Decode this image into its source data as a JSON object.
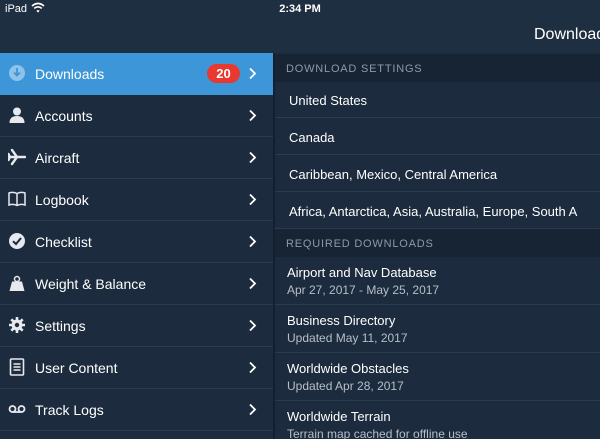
{
  "status": {
    "carrier": "iPad",
    "time": "2:34 PM"
  },
  "nav": {
    "title": "Download"
  },
  "sidebar": {
    "items": [
      {
        "label": "Downloads",
        "badge": "20",
        "icon": "download-icon"
      },
      {
        "label": "Accounts",
        "icon": "person-icon"
      },
      {
        "label": "Aircraft",
        "icon": "airplane-icon"
      },
      {
        "label": "Logbook",
        "icon": "book-icon"
      },
      {
        "label": "Checklist",
        "icon": "checkmark-circle-icon"
      },
      {
        "label": "Weight & Balance",
        "icon": "weight-icon"
      },
      {
        "label": "Settings",
        "icon": "gear-icon"
      },
      {
        "label": "User Content",
        "icon": "document-icon"
      },
      {
        "label": "Track Logs",
        "icon": "voicemail-icon"
      }
    ]
  },
  "download_settings": {
    "header": "DOWNLOAD SETTINGS",
    "regions": [
      "United States",
      "Canada",
      "Caribbean, Mexico, Central America",
      "Africa, Antarctica, Asia, Australia, Europe, South A"
    ]
  },
  "required_downloads": {
    "header": "REQUIRED DOWNLOADS",
    "items": [
      {
        "title": "Airport and Nav Database",
        "subtitle": "Apr 27, 2017 - May 25, 2017"
      },
      {
        "title": "Business Directory",
        "subtitle": "Updated May 11, 2017"
      },
      {
        "title": "Worldwide Obstacles",
        "subtitle": "Updated Apr 28, 2017"
      },
      {
        "title": "Worldwide Terrain",
        "subtitle": "Terrain map cached for offline use"
      }
    ]
  },
  "colors": {
    "accent": "#3d96d8",
    "badge": "#e8382f",
    "background": "#1b2a3c"
  }
}
